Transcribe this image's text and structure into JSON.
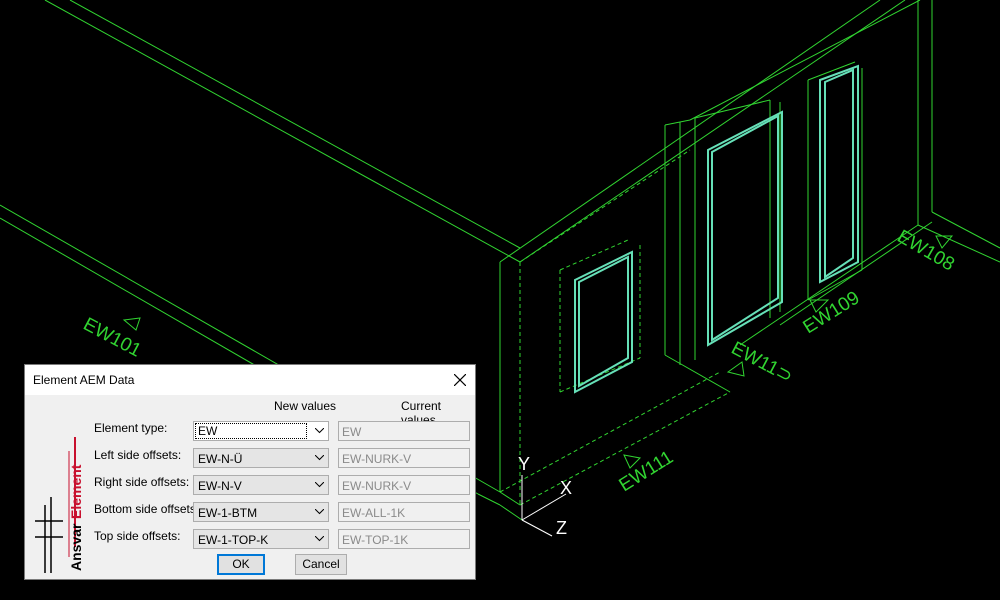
{
  "viewport": {
    "wall_tags": [
      "EW101",
      "EW111",
      "EW11⊃",
      "EW109",
      "EW108"
    ],
    "ucs_axes": {
      "y": "Y",
      "x": "X",
      "z": "Z"
    },
    "line_color": "#31d431",
    "highlight_color": "#66e0b8"
  },
  "dialog": {
    "title": "Element AEM Data",
    "logo_text": [
      "Ansvar",
      "Element"
    ],
    "columns": {
      "new": "New values",
      "current": "Current values"
    },
    "rows": [
      {
        "label": "Element type:",
        "new_value": "EW",
        "current_value": "EW"
      },
      {
        "label": "Left side offsets:",
        "new_value": "EW-N-Ü",
        "current_value": "EW-NURK-V"
      },
      {
        "label": "Right side offsets:",
        "new_value": "EW-N-V",
        "current_value": "EW-NURK-V"
      },
      {
        "label": "Bottom side offsets:",
        "new_value": "EW-1-BTM",
        "current_value": "EW-ALL-1K"
      },
      {
        "label": "Top side offsets:",
        "new_value": "EW-1-TOP-K",
        "current_value": "EW-TOP-1K"
      }
    ],
    "ok_label": "OK",
    "cancel_label": "Cancel",
    "brand_red": "#c8102e"
  }
}
